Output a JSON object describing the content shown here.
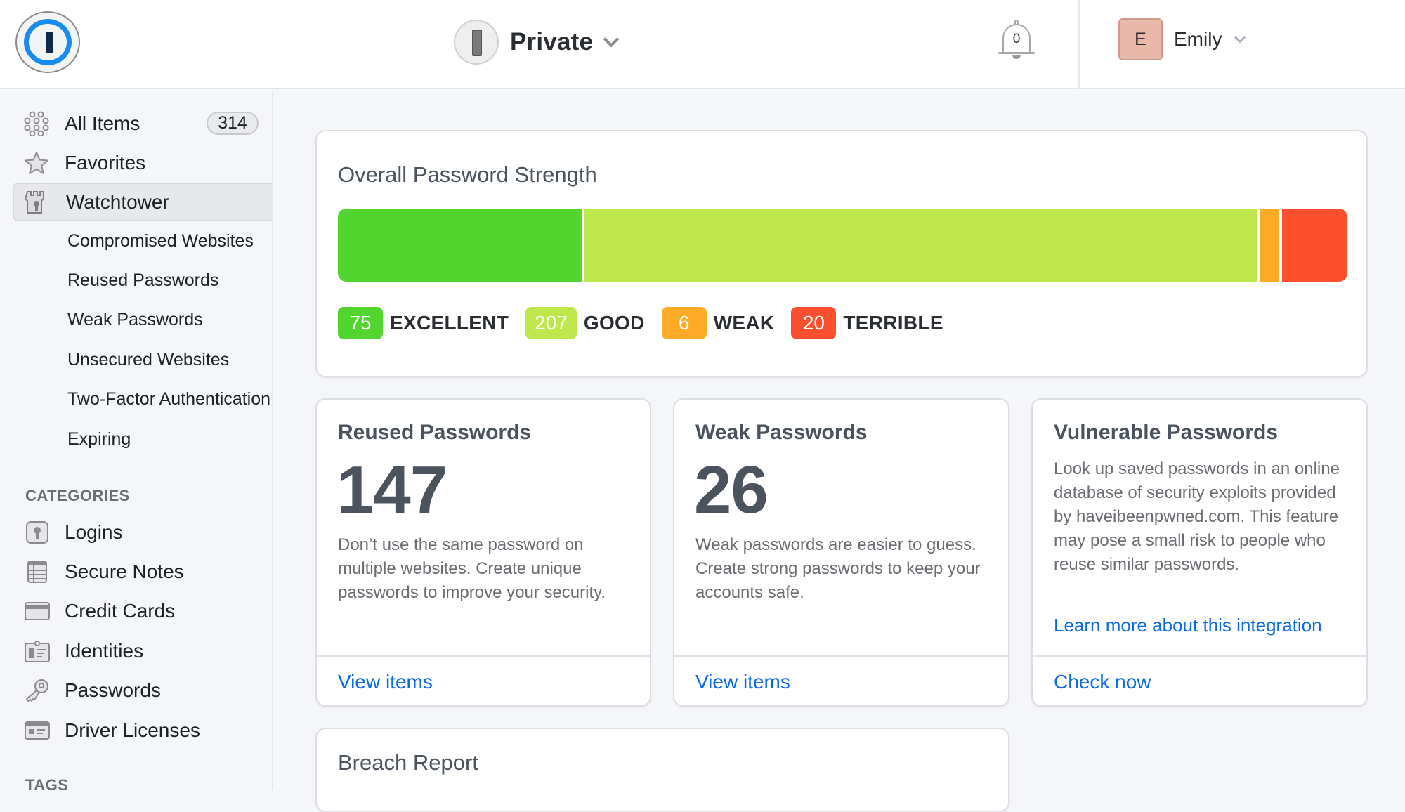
{
  "header": {
    "vault_name": "Private",
    "notification_count": "0",
    "user_initial": "E",
    "user_name": "Emily"
  },
  "sidebar": {
    "items": [
      {
        "label": "All Items",
        "badge": "314",
        "icon": "all-items-icon"
      },
      {
        "label": "Favorites",
        "icon": "star-icon"
      },
      {
        "label": "Watchtower",
        "icon": "watchtower-icon",
        "active": true
      }
    ],
    "watchtower_sub": [
      "Compromised Websites",
      "Reused Passwords",
      "Weak Passwords",
      "Unsecured Websites",
      "Two-Factor Authentication",
      "Expiring"
    ],
    "categories_label": "CATEGORIES",
    "categories": [
      {
        "label": "Logins",
        "icon": "login-icon"
      },
      {
        "label": "Secure Notes",
        "icon": "secure-note-icon"
      },
      {
        "label": "Credit Cards",
        "icon": "credit-card-icon"
      },
      {
        "label": "Identities",
        "icon": "identity-icon"
      },
      {
        "label": "Passwords",
        "icon": "key-icon"
      },
      {
        "label": "Driver Licenses",
        "icon": "driver-license-icon"
      }
    ],
    "tags_label": "TAGS"
  },
  "strength": {
    "title": "Overall Password Strength",
    "segments": [
      {
        "label": "EXCELLENT",
        "count": 75,
        "color": "#53d530"
      },
      {
        "label": "GOOD",
        "count": 207,
        "color": "#bde74a"
      },
      {
        "label": "WEAK",
        "count": 6,
        "color": "#fdab26"
      },
      {
        "label": "TERRIBLE",
        "count": 20,
        "color": "#fb4f30"
      }
    ]
  },
  "cards": {
    "reused": {
      "title": "Reused Passwords",
      "count": "147",
      "description": "Don’t use the same password on multiple websites. Create unique passwords to improve your security.",
      "action": "View items"
    },
    "weak": {
      "title": "Weak Passwords",
      "count": "26",
      "description": "Weak passwords are easier to guess. Create strong passwords to keep your accounts safe.",
      "action": "View items"
    },
    "vulnerable": {
      "title": "Vulnerable Passwords",
      "description": "Look up saved passwords in an online database of security exploits provided by haveibeenpwned.com. This feature may pose a small risk to people who reuse similar passwords.",
      "learn_more": "Learn more about this integration",
      "action": "Check now"
    },
    "breach": {
      "title": "Breach Report"
    }
  }
}
